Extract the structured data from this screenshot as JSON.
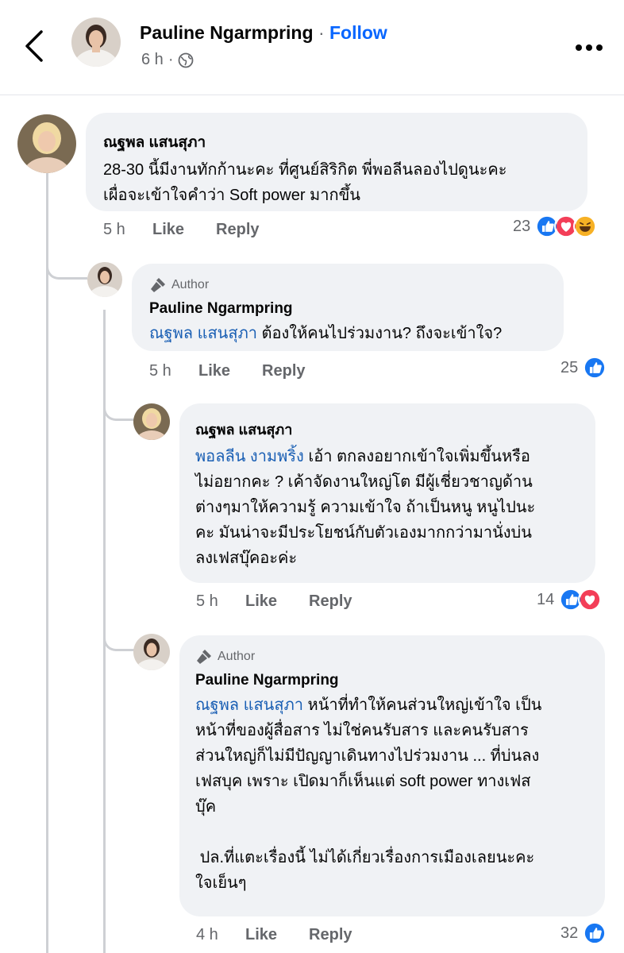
{
  "header": {
    "author_name": "Pauline Ngarmpring",
    "separator": "·",
    "follow_label": "Follow",
    "post_time": "6 h"
  },
  "comments": [
    {
      "name": "ณฐพล แสนสุภา",
      "is_author": false,
      "text": "28-30 นี้มีงานทักก้านะคะ ที่ศูนย์สิริกิต พี่พอลีนลองไปดูนะคะ\nเผื่อจะเข้าใจคำว่า Soft power มากขึ้น",
      "time": "5 h",
      "like_label": "Like",
      "reply_label": "Reply",
      "reaction_count": "23",
      "reactions": [
        "like-icon",
        "love-icon",
        "haha-icon"
      ]
    },
    {
      "name": "Pauline Ngarmpring",
      "is_author": true,
      "author_badge": "Author",
      "mention": "ณฐพล แสนสุภา",
      "text": " ต้องให้คนไปร่วมงาน? ถึงจะเข้าใจ?",
      "time": "5 h",
      "like_label": "Like",
      "reply_label": "Reply",
      "reaction_count": "25",
      "reactions": [
        "like-icon"
      ]
    },
    {
      "name": "ณฐพล แสนสุภา",
      "is_author": false,
      "mention": "พอลลีน งามพริ้ง",
      "text": " เอ้า ตกลงอยากเข้าใจเพิ่มขึ้นหรือ\nไม่อยากคะ ? เค้าจัดงานใหญ่โต มีผู้เชี่ยวชาญด้าน\nต่างๆมาให้ความรู้ ความเข้าใจ ถ้าเป็นหนู หนูไปนะ\nคะ มันน่าจะมีประโยชน์กับตัวเองมากกว่ามานั่งบ่น\nลงเฟสบุ๊คอะค่ะ",
      "time": "5 h",
      "like_label": "Like",
      "reply_label": "Reply",
      "reaction_count": "14",
      "reactions": [
        "like-icon",
        "love-icon"
      ]
    },
    {
      "name": "Pauline Ngarmpring",
      "is_author": true,
      "author_badge": "Author",
      "mention": "ณฐพล แสนสุภา",
      "text": " หน้าที่ทำให้คนส่วนใหญ่เข้าใจ เป็น\nหน้าที่ของผู้สื่อสาร ไม่ใช่คนรับสาร และคนรับสาร\nส่วนใหญ่ก็ไม่มีปัญญาเดินทางไปร่วมงาน ... ที่บ่นลง\nเฟสบุค เพราะ เปิดมาก็เห็นแต่ soft power ทางเฟส\nบุ๊ค\n\n ปล.ที่แตะเรื่องนี้ ไม่ได้เกี่ยวเรื่องการเมืองเลยนะคะ\nใจเย็นๆ",
      "time": "4 h",
      "like_label": "Like",
      "reply_label": "Reply",
      "reaction_count": "32",
      "reactions": [
        "like-icon"
      ]
    }
  ],
  "colors": {
    "link": "#1a5fb4",
    "follow": "#0866ff",
    "bubble": "#f0f2f5",
    "like": "#1877f2",
    "love": "#f33e58",
    "haha": "#f7b125"
  }
}
